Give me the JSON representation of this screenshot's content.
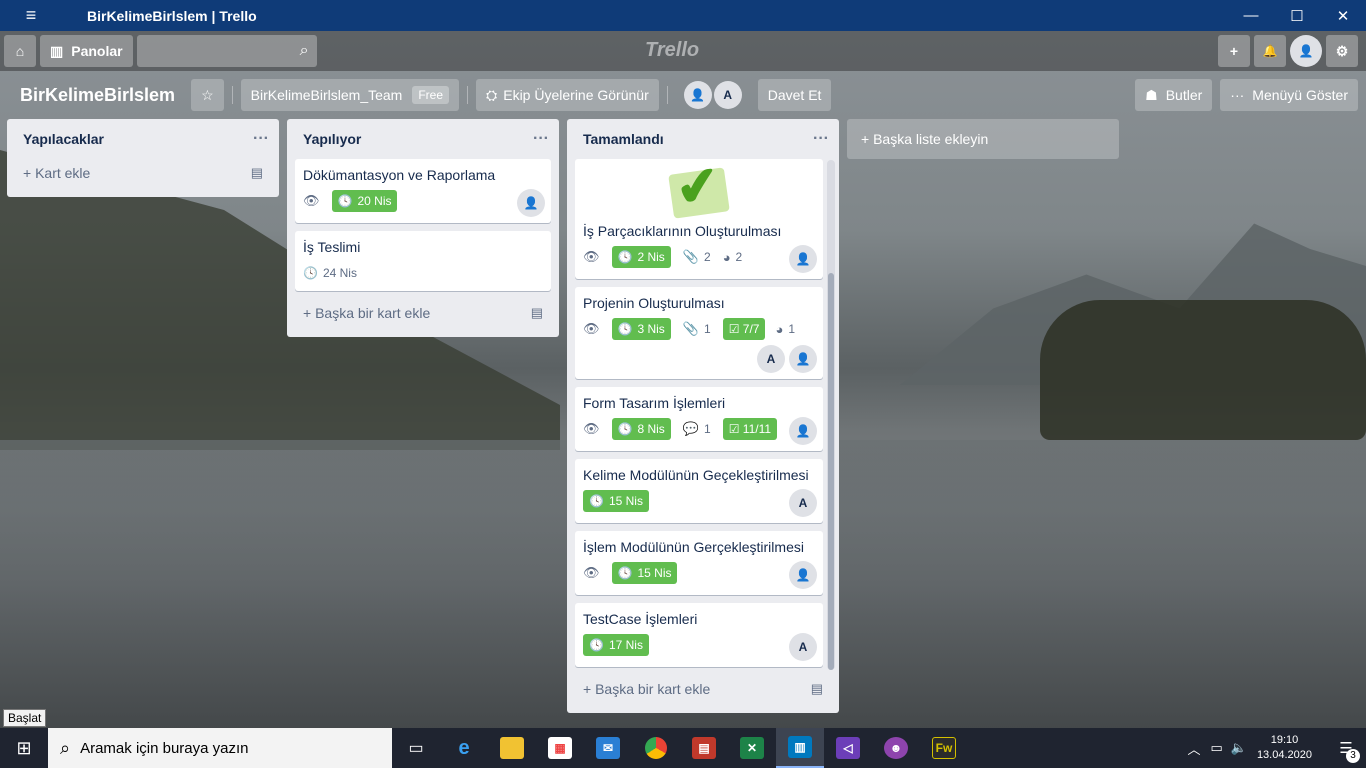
{
  "window": {
    "title": "BirKelimeBirlslem | Trello",
    "menu_icon": "≡",
    "minimize": "—",
    "maximize": "☐",
    "close": "✕"
  },
  "header": {
    "home_icon": "⌂",
    "boards_label": "Panolar",
    "search_icon": "⌕",
    "logo": "Trello",
    "add_icon": "+",
    "bell_icon": "🔔",
    "profile_icon": "👤",
    "settings_icon": "⚙"
  },
  "board": {
    "title": "BirKelimeBirlslem",
    "star_icon": "☆",
    "team_label": "BirKelimeBirlslem_Team",
    "team_badge": "Free",
    "visibility_label": "Ekip Üyelerine Görünür",
    "members": [
      "👤",
      "A"
    ],
    "invite_label": "Davet Et",
    "butler_label": "Butler",
    "menu_label": "Menüyü Göster"
  },
  "lists": [
    {
      "title": "Yapılacaklar",
      "menu": "···",
      "add_card": "+ Kart ekle",
      "template_icon": "▤"
    },
    {
      "title": "Yapılıyor",
      "menu": "···",
      "add_card": "+ Başka bir kart ekle",
      "template_icon": "▤",
      "cards": [
        {
          "title": "Dökümantasyon ve Raporlama",
          "due": "20 Nis",
          "member": "👤"
        },
        {
          "title": "İş Teslimi",
          "due": "24 Nis"
        }
      ]
    },
    {
      "title": "Tamamlandı",
      "menu": "···",
      "add_card": "+ Başka bir kart ekle",
      "template_icon": "▤",
      "cards": [
        {
          "title": "İş Parçacıklarının Oluşturulması",
          "due": "2 Nis",
          "attachments": "2",
          "github": "2",
          "member": "👤"
        },
        {
          "title": "Projenin Oluşturulması",
          "due": "3 Nis",
          "attachments": "1",
          "checklist": "7/7",
          "github": "1",
          "members": [
            "A",
            "👤"
          ]
        },
        {
          "title": "Form Tasarım İşlemleri",
          "due": "8 Nis",
          "comments": "1",
          "checklist": "11/11",
          "member": "👤"
        },
        {
          "title": "Kelime Modülünün Geçekleştirilmesi",
          "due": "15 Nis",
          "member": "A"
        },
        {
          "title": "İşlem Modülünün Gerçekleştirilmesi",
          "due": "15 Nis",
          "member": "👤"
        },
        {
          "title": "TestCase İşlemleri",
          "due": "17 Nis",
          "member": "A"
        }
      ]
    }
  ],
  "add_list": "+ Başka liste ekleyin",
  "icons": {
    "eye": "👁",
    "clock": "🕓",
    "clip": "📎",
    "github": "◕",
    "comment": "💬",
    "check": "☑"
  },
  "tooltip": "Başlat",
  "taskbar": {
    "start_icon": "⊞",
    "search_placeholder": "Aramak için buraya yazın",
    "search_icon": "⌕",
    "apps": [
      "task-view",
      "edge",
      "file-explorer",
      "store",
      "mail",
      "chrome",
      "app-red",
      "app-excel",
      "trello",
      "visual-studio",
      "github-desktop",
      "fireworks"
    ],
    "time": "19:10",
    "date": "13.04.2020",
    "notification_count": "3",
    "colors": {
      "taskbar": "#1f2430",
      "trello": "#0079bf",
      "due_green": "#61bd4f"
    }
  }
}
